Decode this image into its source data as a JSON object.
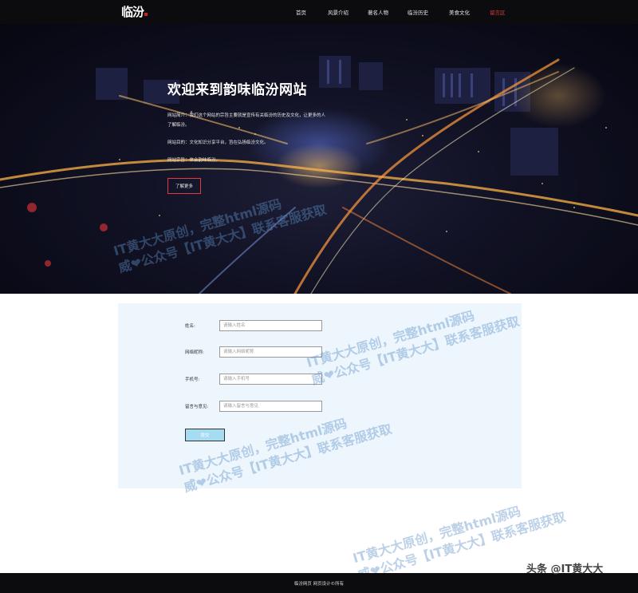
{
  "nav": {
    "logo": "临汾",
    "items": [
      {
        "label": "首页"
      },
      {
        "label": "风景介绍"
      },
      {
        "label": "著名人物"
      },
      {
        "label": "临汾历史"
      },
      {
        "label": "美食文化"
      },
      {
        "label": "留言区"
      }
    ],
    "active_index": 5,
    "active_color": "#e23b3b"
  },
  "hero": {
    "title": "欢迎来到韵味临汾网站",
    "paragraphs": [
      "网站简介：我们这个网站的宗旨主要就是宣传有关临汾的历史及文化，让更多的人了解临汾。",
      "网站目的：文化知识分享平台，旨在弘扬临汾文化。",
      "网站宗旨：体会韵味临汾。"
    ],
    "button_label": "了解更多"
  },
  "form": {
    "fields": [
      {
        "label": "姓名:",
        "placeholder": "请输入姓名"
      },
      {
        "label": "网络昵称:",
        "placeholder": "请输入网络昵称"
      },
      {
        "label": "手机号:",
        "placeholder": "请输入手机号"
      },
      {
        "label": "留言与意见:",
        "placeholder": "请输入留言与意见"
      }
    ],
    "submit_label": "提交"
  },
  "watermarks": [
    {
      "line1": "IT黄大大原创，完整html源码",
      "line2": "威❤公众号【IT黄大大】联系客服获取"
    },
    {
      "line1": "IT黄大大原创，完整html源码",
      "line2": "威❤公众号【IT黄大大】联系客服获取"
    },
    {
      "line1": "IT黄大大原创，完整html源码",
      "line2": "威❤公众号【IT黄大大】联系客服获取"
    },
    {
      "line1": "IT黄大大原创，完整html源码",
      "line2": "威❤公众号【IT黄大大】联系客服获取"
    }
  ],
  "footer": {
    "text": "临汾网页 网页设计©所有"
  },
  "badge": "头条 @IT黄大大"
}
